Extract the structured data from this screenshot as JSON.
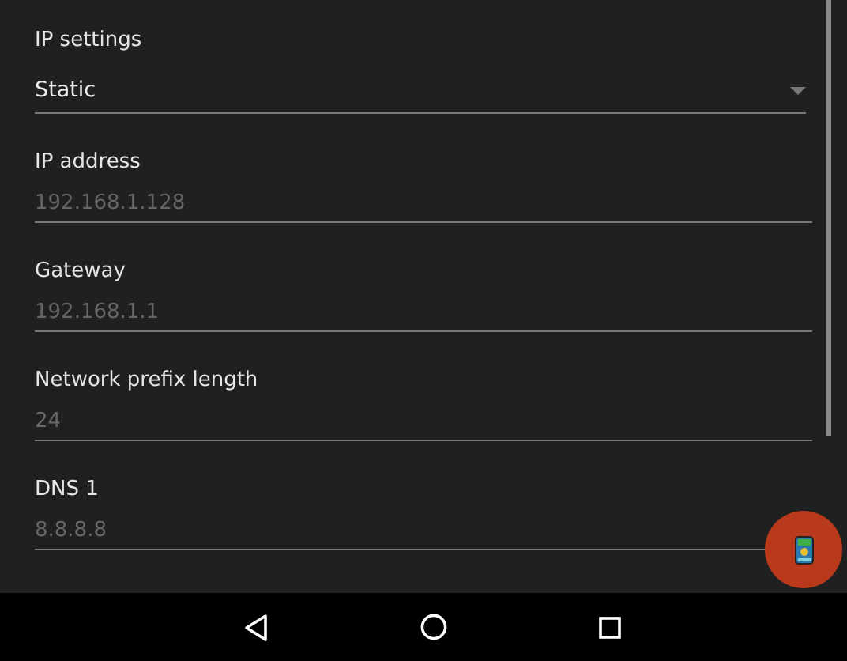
{
  "fields": [
    {
      "kind": "spinner",
      "label": "IP settings",
      "value": "Static"
    },
    {
      "kind": "text",
      "label": "IP address",
      "placeholder": "192.168.1.128"
    },
    {
      "kind": "text",
      "label": "Gateway",
      "placeholder": "192.168.1.1"
    },
    {
      "kind": "text",
      "label": "Network prefix length",
      "placeholder": "24"
    },
    {
      "kind": "text",
      "label": "DNS 1",
      "placeholder": "8.8.8.8"
    }
  ]
}
